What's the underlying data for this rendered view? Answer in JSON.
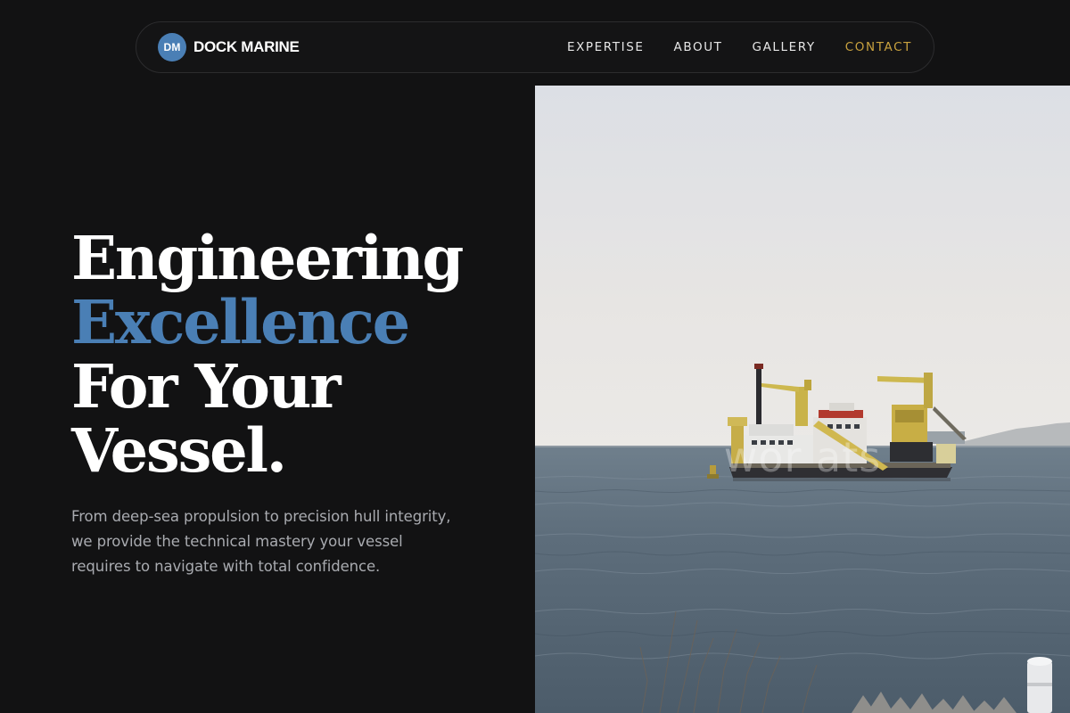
{
  "brand": {
    "logo_initials": "DM",
    "name": "DOCK MARINE"
  },
  "nav": {
    "links": [
      {
        "label": "EXPERTISE"
      },
      {
        "label": "ABOUT"
      },
      {
        "label": "GALLERY"
      },
      {
        "label": "CONTACT"
      }
    ]
  },
  "hero": {
    "title_line1": "Engineering",
    "title_line2": "Excellence",
    "title_line3": "For Your",
    "title_line4": "Vessel.",
    "description": "From deep-sea propulsion to precision hull integrity, we provide the technical mastery your vessel requires to navigate with total confidence."
  },
  "image": {
    "subject": "dredging vessel on open water",
    "watermark": "wor           ats"
  },
  "colors": {
    "background": "#121213",
    "accent_blue": "#4a7fb5",
    "accent_gold": "#c9a23f",
    "text_muted": "#a9abb0"
  }
}
